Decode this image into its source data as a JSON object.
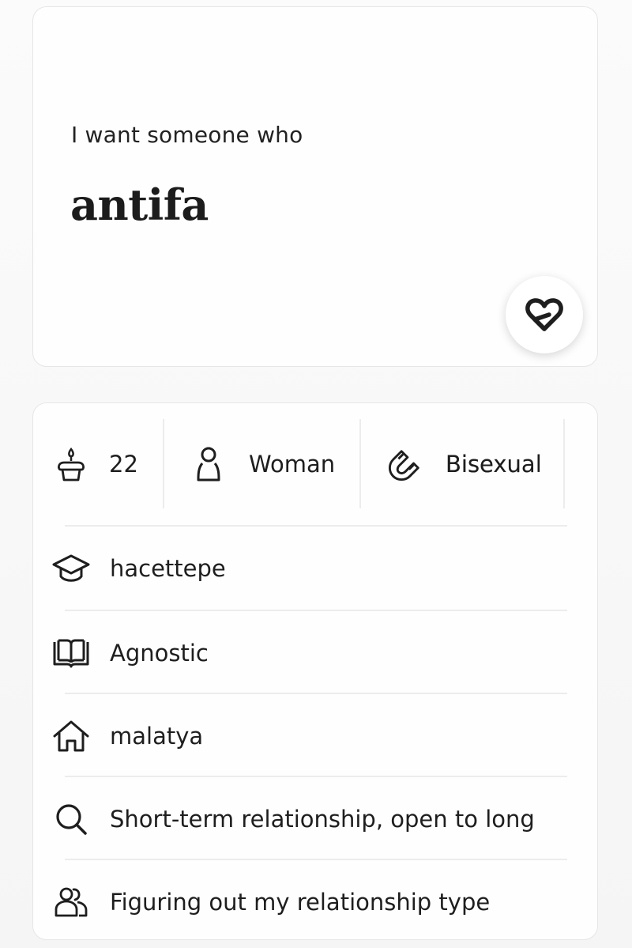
{
  "prompt": {
    "question": "I want someone who",
    "answer": "antifa"
  },
  "vitals": [
    {
      "icon": "cake-icon",
      "value": "22"
    },
    {
      "icon": "person-icon",
      "value": "Woman"
    },
    {
      "icon": "magnet-icon",
      "value": "Bisexual"
    }
  ],
  "details": [
    {
      "icon": "graduation-cap-icon",
      "value": "hacettepe"
    },
    {
      "icon": "book-icon",
      "value": "Agnostic"
    },
    {
      "icon": "home-icon",
      "value": "malatya"
    },
    {
      "icon": "search-icon",
      "value": "Short-term relationship, open to long"
    },
    {
      "icon": "people-icon",
      "value": "Figuring out my relationship type"
    }
  ]
}
